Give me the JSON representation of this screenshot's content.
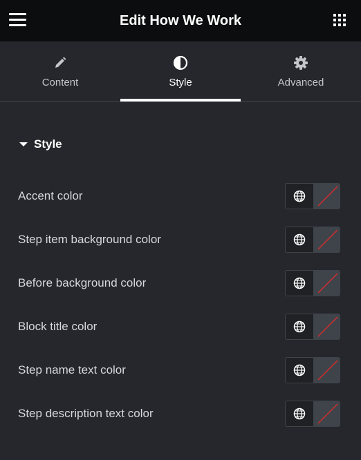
{
  "header": {
    "title": "Edit How We Work",
    "menu_icon": "hamburger-icon",
    "apps_icon": "grid-icon"
  },
  "tabs": [
    {
      "label": "Content",
      "icon": "pencil-icon",
      "active": false
    },
    {
      "label": "Style",
      "icon": "contrast-icon",
      "active": true
    },
    {
      "label": "Advanced",
      "icon": "gear-icon",
      "active": false
    }
  ],
  "section": {
    "title": "Style",
    "expanded": true
  },
  "controls": [
    {
      "label": "Accent color"
    },
    {
      "label": "Step item background color"
    },
    {
      "label": "Before background color"
    },
    {
      "label": "Block title color"
    },
    {
      "label": "Step name text color"
    },
    {
      "label": "Step description text color"
    }
  ],
  "colors": {
    "header_bg": "#0c0d0e",
    "panel_bg": "#26272c",
    "swatch_empty": "#3f444b",
    "slash": "#d12c2c"
  }
}
